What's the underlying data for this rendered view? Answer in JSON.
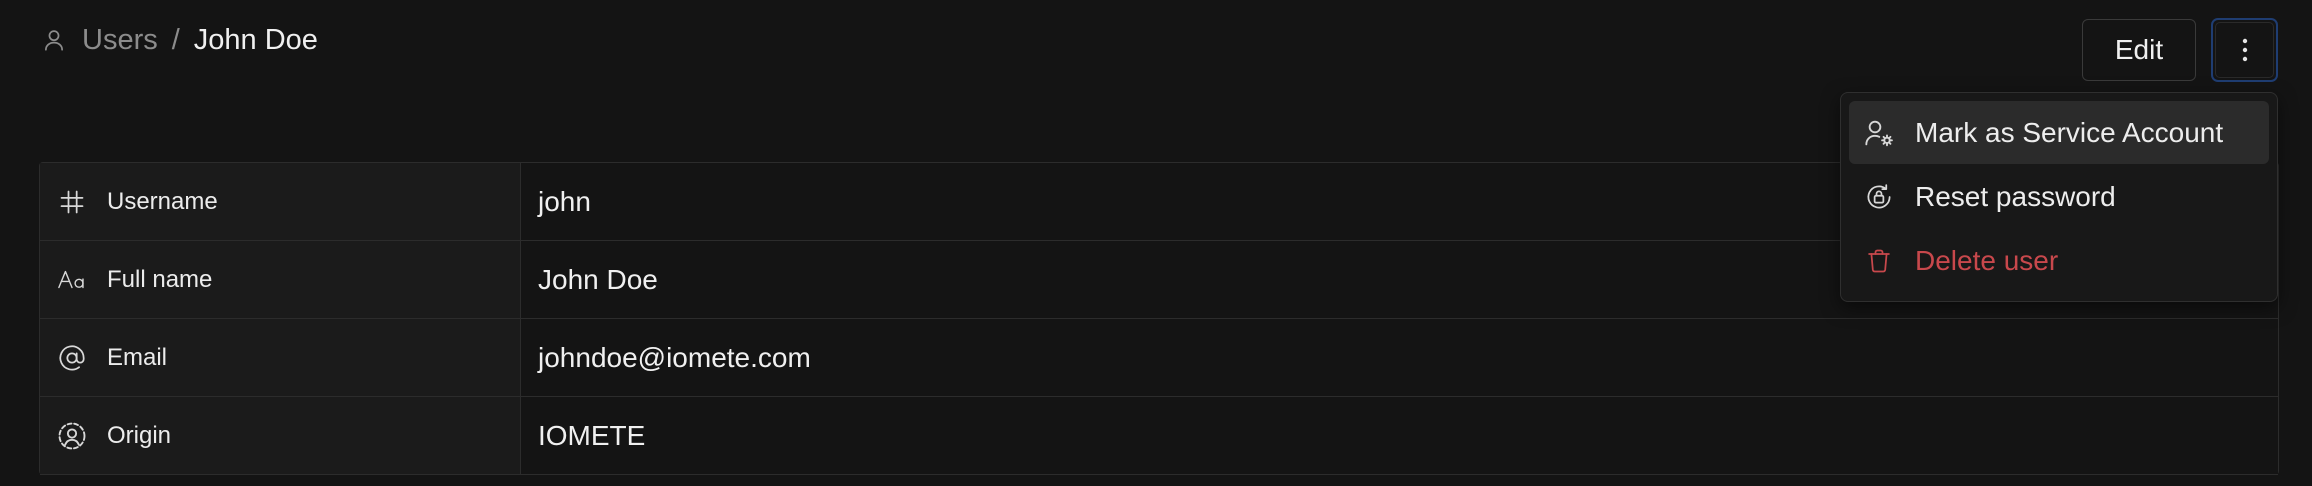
{
  "breadcrumb": {
    "parent": "Users",
    "separator": "/",
    "current": "John Doe",
    "icon": "user-icon"
  },
  "header": {
    "edit_label": "Edit",
    "more_icon": "more-vertical-icon"
  },
  "details": {
    "rows": [
      {
        "icon": "hash-icon",
        "label": "Username",
        "value": "john"
      },
      {
        "icon": "text-case-icon",
        "label": "Full name",
        "value": "John Doe"
      },
      {
        "icon": "at-sign-icon",
        "label": "Email",
        "value": "johndoe@iomete.com"
      },
      {
        "icon": "user-circle-dashed-icon",
        "label": "Origin",
        "value": "IOMETE"
      }
    ]
  },
  "menu": {
    "items": [
      {
        "icon": "user-gear-icon",
        "label": "Mark as Service Account",
        "state": "hover"
      },
      {
        "icon": "reset-lock-icon",
        "label": "Reset password"
      },
      {
        "icon": "trash-icon",
        "label": "Delete user",
        "color": "#c8484c"
      }
    ]
  },
  "colors": {
    "background": "#141414",
    "label_cell": "#1b1b1b",
    "border": "#2c2c2c",
    "focus_ring": "#1f3d72",
    "danger": "#c8484c"
  }
}
